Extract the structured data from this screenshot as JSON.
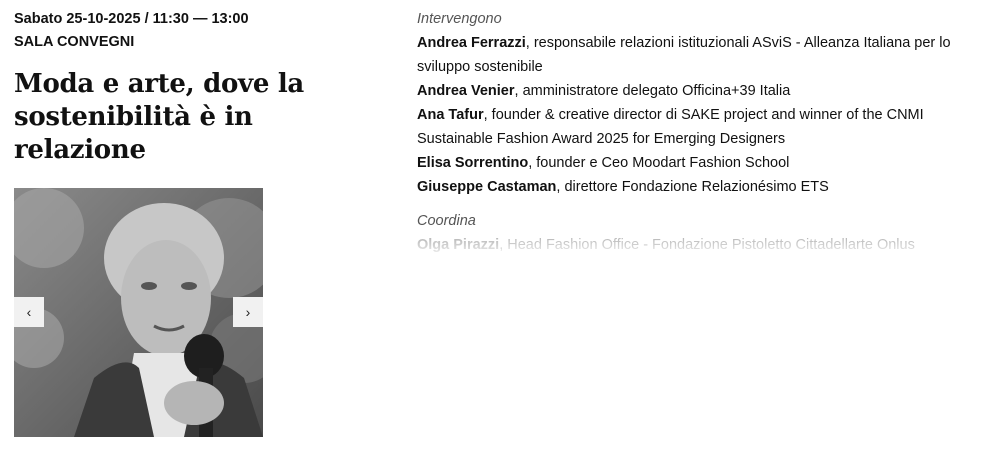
{
  "event": {
    "date_time": "Sabato 25-10-2025 / 11:30 — 13:00",
    "room": "SALA CONVEGNI",
    "title": "Moda e arte, dove la sostenibilità è in relazione"
  },
  "gallery": {
    "prev_icon": "chevron-left",
    "next_icon": "chevron-right",
    "prev_glyph": "‹",
    "next_glyph": "›"
  },
  "speakers_section": {
    "label": "Intervengono",
    "speakers": [
      {
        "name": "Andrea Ferrazzi",
        "role": ", responsabile relazioni istituzionali ASviS - Alleanza Italiana per lo sviluppo sostenibile"
      },
      {
        "name": "Andrea Venier",
        "role": ", amministratore delegato Officina+39 Italia"
      },
      {
        "name": "Ana Tafur",
        "role": ", founder & creative director di SAKE project and winner of the CNMI Sustainable Fashion Award 2025 for Emerging Designers"
      },
      {
        "name": "Elisa Sorrentino",
        "role": ", founder e Ceo Moodart Fashion School"
      },
      {
        "name": "Giuseppe Castaman",
        "role": ", direttore Fondazione Relazionésimo ETS"
      }
    ]
  },
  "coordinator_section": {
    "label": "Coordina",
    "name": "Olga Pirazzi",
    "role": ", Head Fashion Office - Fondazione Pistoletto Cittadellarte Onlus"
  }
}
